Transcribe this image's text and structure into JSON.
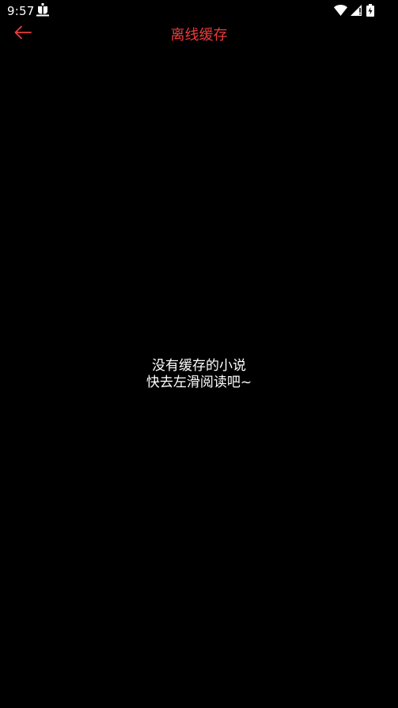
{
  "status_bar": {
    "time": "9:57",
    "icons": [
      "bug-icon",
      "wifi-icon",
      "signal-icon",
      "battery-icon"
    ]
  },
  "header": {
    "back_icon": "back-arrow-icon",
    "title": "离线缓存",
    "accent_color": "#ee3b3b"
  },
  "empty_state": {
    "line1": "没有缓存的小说",
    "line2": "快去左滑阅读吧~"
  },
  "colors": {
    "background": "#000000",
    "text": "#ffffff",
    "accent": "#ee3b3b"
  }
}
